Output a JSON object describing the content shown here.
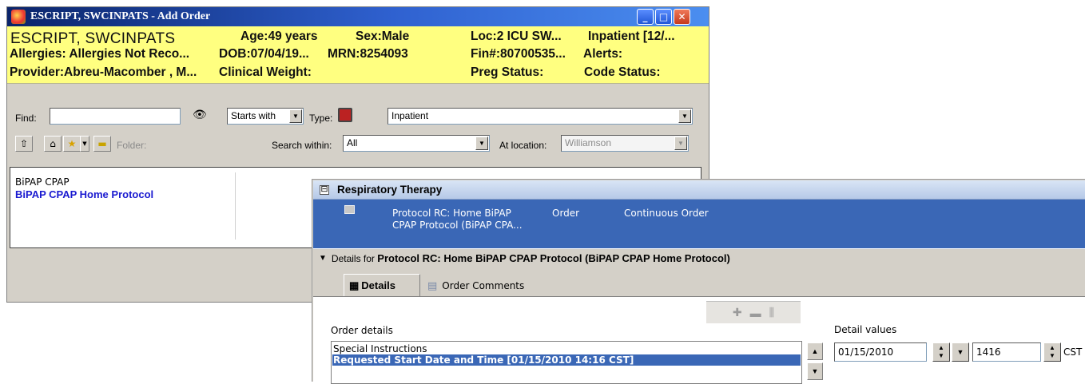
{
  "window": {
    "title": "ESCRIPT, SWCINPATS - Add Order",
    "controls": {
      "minimize": "_",
      "maximize": "□",
      "close": "✕"
    }
  },
  "banner": {
    "name": "ESCRIPT, SWCINPATS",
    "age": "Age:49 years",
    "sex": "Sex:Male",
    "loc": "Loc:2 ICU SW...",
    "encounter": "Inpatient [12/...",
    "allergies": "Allergies: Allergies Not Reco...",
    "dob": "DOB:07/04/19...",
    "mrn": "MRN:8254093",
    "fin": "Fin#:80700535...",
    "alerts": "Alerts:",
    "provider": "Provider:Abreu-Macomber , M...",
    "weight": "Clinical Weight:",
    "preg": "Preg Status:",
    "code": "Code Status:"
  },
  "search": {
    "find_label": "Find:",
    "find_value": "",
    "binoculars_icon": "binoculars-icon",
    "match_mode": "Starts with",
    "type_label": "Type:",
    "type_value": "Inpatient",
    "folder_label": "Folder:",
    "search_within_label": "Search within:",
    "search_within_value": "All",
    "at_location_label": "At location:",
    "at_location_value": "Williamson"
  },
  "results": {
    "items": [
      {
        "label": "BiPAP CPAP"
      },
      {
        "label": "BiPAP CPAP Home Protocol"
      }
    ]
  },
  "orders": {
    "section": "Respiratory Therapy",
    "collapse_glyph": "⊟",
    "row": {
      "name_line1": "Protocol RC: Home BiPAP",
      "name_line2": "CPAP Protocol (BiPAP CPA...",
      "type": "Order",
      "details": "Continuous Order"
    },
    "details_prefix": "Details for",
    "details_name": "Protocol RC: Home BiPAP CPAP Protocol (BiPAP CPAP Home Protocol)",
    "tabs": [
      {
        "label": "Details"
      },
      {
        "label": "Order Comments"
      }
    ],
    "order_details_label": "Order details",
    "detail_values_label": "Detail values",
    "detail_rows": [
      {
        "label": "Special Instructions"
      },
      {
        "label": "Requested Start Date and Time    [01/15/2010 14:16 CST]"
      }
    ],
    "date_value": "01/15/2010",
    "time_value": "1416",
    "tz_value": "CST"
  },
  "colors": {
    "banner_bg": "#ffff80",
    "selection": "#3a67b6",
    "link_blue": "#1a1ad0"
  }
}
